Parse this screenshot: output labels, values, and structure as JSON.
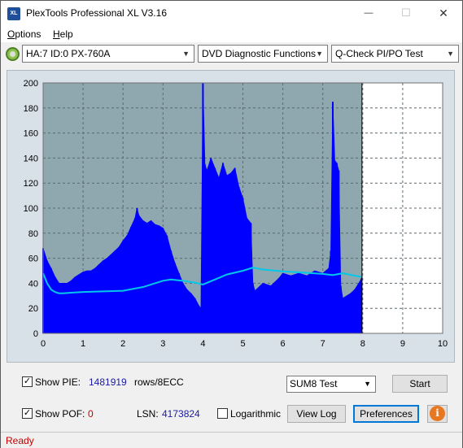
{
  "window": {
    "title": "PlexTools Professional XL V3.16",
    "icon_label": "XL",
    "minimize_glyph": "—",
    "maximize_glyph": "☐",
    "close_glyph": "✕"
  },
  "menu": {
    "items": [
      "Options",
      "Help"
    ]
  },
  "toolbar": {
    "drive": "HA:7 ID:0  PX-760A",
    "function": "DVD Diagnostic Functions",
    "test": "Q-Check PI/PO Test"
  },
  "chart_data": {
    "type": "area",
    "xlim": [
      0,
      10
    ],
    "ylim": [
      0,
      200
    ],
    "x_ticks": [
      "0",
      "1",
      "2",
      "3",
      "4",
      "5",
      "6",
      "7",
      "8",
      "9",
      "10"
    ],
    "y_ticks": [
      "0",
      "20",
      "40",
      "60",
      "80",
      "100",
      "120",
      "140",
      "160",
      "180",
      "200"
    ],
    "grid": true,
    "plot_background": "#8fa7ae",
    "series": [
      {
        "color": "#0000ff",
        "style": "bars",
        "points": [
          [
            0.0,
            68
          ],
          [
            0.1,
            58
          ],
          [
            0.2,
            52
          ],
          [
            0.3,
            45
          ],
          [
            0.4,
            40
          ],
          [
            0.5,
            40
          ],
          [
            0.6,
            40
          ],
          [
            0.7,
            42
          ],
          [
            0.8,
            45
          ],
          [
            0.9,
            47
          ],
          [
            1.0,
            49
          ],
          [
            1.1,
            50
          ],
          [
            1.2,
            50
          ],
          [
            1.3,
            52
          ],
          [
            1.4,
            55
          ],
          [
            1.5,
            58
          ],
          [
            1.6,
            60
          ],
          [
            1.7,
            63
          ],
          [
            1.8,
            66
          ],
          [
            1.9,
            69
          ],
          [
            2.0,
            74
          ],
          [
            2.1,
            78
          ],
          [
            2.2,
            85
          ],
          [
            2.3,
            92
          ],
          [
            2.35,
            100
          ],
          [
            2.4,
            94
          ],
          [
            2.5,
            90
          ],
          [
            2.6,
            88
          ],
          [
            2.7,
            90
          ],
          [
            2.8,
            87
          ],
          [
            2.9,
            86
          ],
          [
            3.0,
            84
          ],
          [
            3.1,
            78
          ],
          [
            3.2,
            66
          ],
          [
            3.3,
            56
          ],
          [
            3.4,
            48
          ],
          [
            3.5,
            40
          ],
          [
            3.6,
            35
          ],
          [
            3.7,
            32
          ],
          [
            3.8,
            28
          ],
          [
            3.9,
            22
          ],
          [
            3.95,
            20
          ],
          [
            4.0,
            200
          ],
          [
            4.05,
            135
          ],
          [
            4.1,
            130
          ],
          [
            4.2,
            140
          ],
          [
            4.3,
            132
          ],
          [
            4.4,
            124
          ],
          [
            4.5,
            136
          ],
          [
            4.6,
            126
          ],
          [
            4.7,
            128
          ],
          [
            4.8,
            132
          ],
          [
            4.9,
            117
          ],
          [
            5.0,
            108
          ],
          [
            5.1,
            92
          ],
          [
            5.2,
            88
          ],
          [
            5.25,
            40
          ],
          [
            5.3,
            34
          ],
          [
            5.5,
            40
          ],
          [
            5.7,
            38
          ],
          [
            5.9,
            44
          ],
          [
            6.0,
            48
          ],
          [
            6.2,
            46
          ],
          [
            6.4,
            48
          ],
          [
            6.6,
            46
          ],
          [
            6.8,
            50
          ],
          [
            7.0,
            48
          ],
          [
            7.15,
            52
          ],
          [
            7.2,
            66
          ],
          [
            7.25,
            185
          ],
          [
            7.3,
            138
          ],
          [
            7.35,
            136
          ],
          [
            7.4,
            130
          ],
          [
            7.45,
            38
          ],
          [
            7.5,
            28
          ],
          [
            7.6,
            30
          ],
          [
            7.7,
            32
          ],
          [
            7.8,
            35
          ],
          [
            7.9,
            40
          ],
          [
            7.97,
            44
          ]
        ]
      },
      {
        "color": "#00c8e8",
        "style": "line",
        "points": [
          [
            0.0,
            48
          ],
          [
            0.1,
            40
          ],
          [
            0.2,
            35
          ],
          [
            0.3,
            33
          ],
          [
            0.4,
            32
          ],
          [
            0.5,
            32
          ],
          [
            0.7,
            32.5
          ],
          [
            1.0,
            33
          ],
          [
            1.5,
            33.5
          ],
          [
            2.0,
            34
          ],
          [
            2.5,
            37
          ],
          [
            3.0,
            42
          ],
          [
            3.2,
            43
          ],
          [
            3.5,
            42
          ],
          [
            3.8,
            40.5
          ],
          [
            4.0,
            39
          ],
          [
            4.3,
            43
          ],
          [
            4.6,
            47
          ],
          [
            5.0,
            50
          ],
          [
            5.25,
            52.5
          ],
          [
            5.5,
            51
          ],
          [
            6.0,
            49.5
          ],
          [
            6.5,
            48.5
          ],
          [
            7.0,
            47.5
          ],
          [
            7.25,
            46.5
          ],
          [
            7.5,
            48
          ],
          [
            7.8,
            46
          ],
          [
            8.0,
            45
          ]
        ]
      }
    ],
    "test_end_x": 7.98
  },
  "controls": {
    "show_pie_label": "Show PIE:",
    "pie_value": "1481919",
    "pie_unit": "rows/8ECC",
    "show_pof_label": "Show POF:",
    "pof_value": "0",
    "lsn_label": "LSN:",
    "lsn_value": "4173824",
    "logarithmic_label": "Logarithmic",
    "sum_select": "SUM8 Test",
    "start_button": "Start",
    "view_log_button": "View Log",
    "preferences_button": "Preferences",
    "info_glyph": "i",
    "check_glyph": "✓"
  },
  "status": {
    "text": "Ready"
  }
}
